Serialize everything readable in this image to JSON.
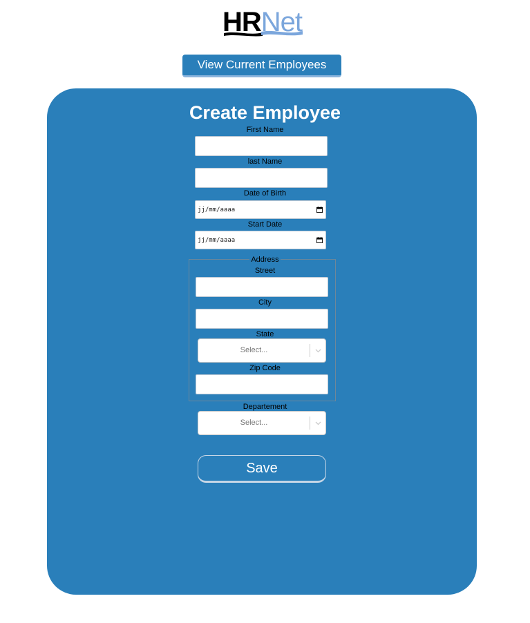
{
  "logo": {
    "hr": "HR",
    "net": "Net"
  },
  "nav": {
    "view_employees_label": "View Current Employees"
  },
  "form": {
    "title": "Create Employee",
    "first_name_label": "First Name",
    "last_name_label": "last Name",
    "dob_label": "Date of Birth",
    "dob_placeholder": "jj/mm/aaaa",
    "start_date_label": "Start Date",
    "start_date_placeholder": "jj/mm/aaaa",
    "address": {
      "legend": "Address",
      "street_label": "Street",
      "city_label": "City",
      "state_label": "State",
      "state_placeholder": "Select...",
      "zip_label": "Zip Code"
    },
    "department_label": "Departement",
    "department_placeholder": "Select...",
    "save_label": "Save"
  },
  "colors": {
    "primary": "#2a7fba",
    "logo_accent": "#7ba6dc",
    "button_underline": "#8bb4dd"
  },
  "icons": {
    "date_picker": "calendar-icon",
    "select_toggle": "chevron-down-icon"
  }
}
